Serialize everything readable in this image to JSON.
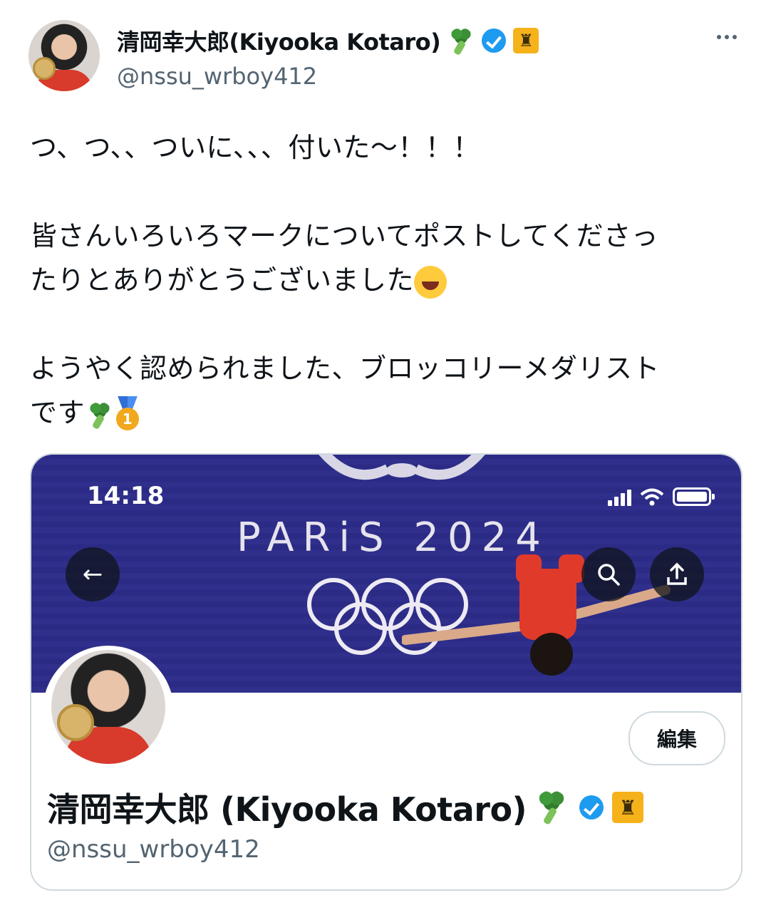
{
  "tweet": {
    "author_name": "清岡幸大郎(Kiyooka Kotaro)",
    "author_handle": "@nssu_wrboy412",
    "lines": [
      "つ、つ、、ついに、、、付いた〜！！！",
      "皆さんいろいろマークについてポストしてくださっ",
      "たりとありがとうございました",
      "ようやく認められました、ブロッコリーメダリスト",
      "です"
    ],
    "medal_number": "1"
  },
  "card": {
    "status_time": "14:18",
    "banner_text": "PARiS 2024",
    "edit_label": "編集",
    "display_name": "清岡幸大郎 (Kiyooka Kotaro)",
    "handle": "@nssu_wrboy412"
  },
  "colors": {
    "banner": "#2c2c8a",
    "verified": "#1d9bf0",
    "singlet": "#d83a2b"
  },
  "icons": [
    "broccoli-icon",
    "verified-icon",
    "eiffel-tower-icon",
    "laughing-emoji-icon",
    "gold-medal-icon",
    "back-arrow-icon",
    "search-icon",
    "share-icon",
    "more-icon"
  ]
}
